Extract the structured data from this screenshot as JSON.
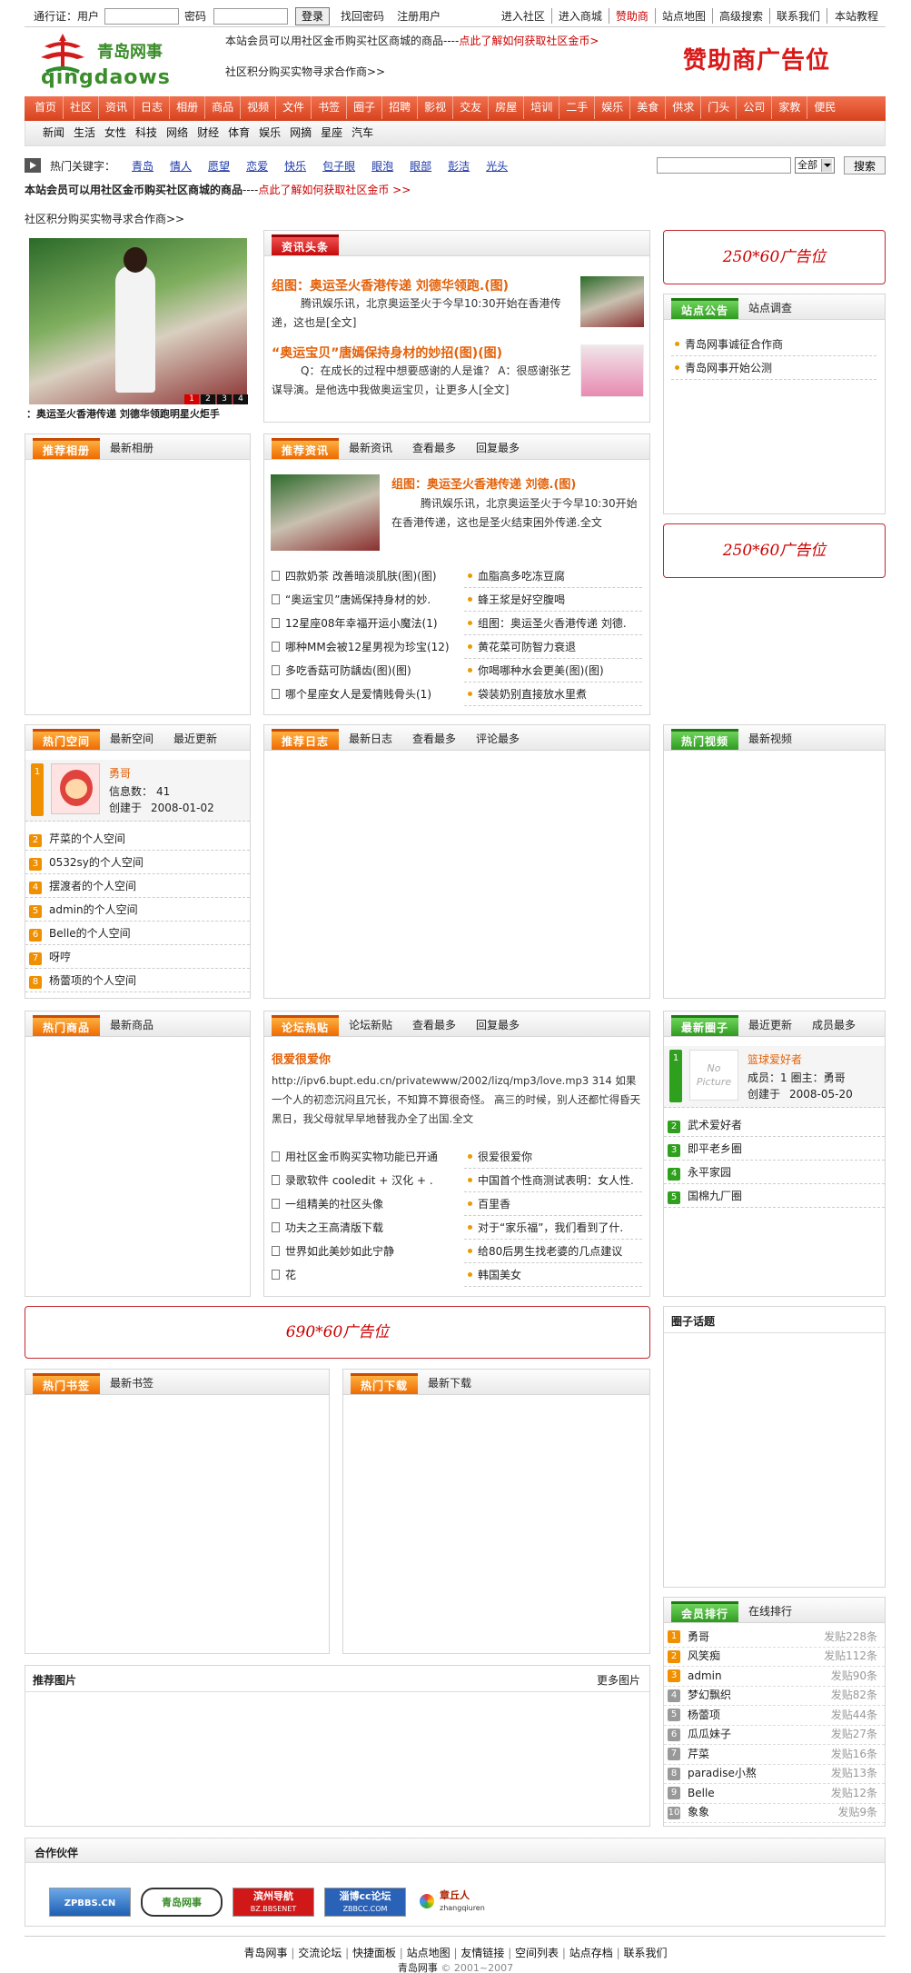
{
  "top": {
    "pass_label": "通行证：用户",
    "pwd_label": "密码",
    "login_btn": "登录",
    "retrieve": "找回密码",
    "register": "注册用户",
    "links": [
      "进入社区",
      "进入商城",
      "赞助商",
      "站点地图",
      "高级搜索",
      "联系我们",
      "本站教程"
    ]
  },
  "logo": {
    "cn": "青岛网事",
    "en": "qingdaows"
  },
  "notice": {
    "line1a": "本站会员可以用社区金币购买社区商城的商品----",
    "line1b": "点此了解如何获取社区金币>",
    "line2": "社区积分购买实物寻求合作商>>"
  },
  "sponsor": "赞助商广告位",
  "nav": [
    "首页",
    "社区",
    "资讯",
    "日志",
    "相册",
    "商品",
    "视频",
    "文件",
    "书签",
    "圈子",
    "招聘",
    "影视",
    "交友",
    "房屋",
    "培训",
    "二手",
    "娱乐",
    "美食",
    "供求",
    "门头",
    "公司",
    "家教",
    "便民"
  ],
  "subnav": [
    "新闻",
    "生活",
    "女性",
    "科技",
    "网络",
    "财经",
    "体育",
    "娱乐",
    "网摘",
    "星座",
    "汽车"
  ],
  "hot": {
    "label": "热门关键字：",
    "words": [
      "青岛",
      "情人",
      "愿望",
      "恋爱",
      "快乐",
      "包子眼",
      "眼泡",
      "眼部",
      "彭洁",
      "光头"
    ],
    "select": "全部",
    "search_btn": "搜索"
  },
  "notice2": {
    "a": "本站会员可以用社区金币购买社区商城的商品",
    "b": "----",
    "c": "点此了解如何获取社区金币 >>",
    "d": "社区积分购买实物寻求合作商>>"
  },
  "slide": {
    "caption": "：奥运圣火香港传递 刘德华领跑明星火炬手",
    "pages": [
      "1",
      "2",
      "3",
      "4"
    ]
  },
  "news_head": {
    "tab": "资讯头条",
    "item1": {
      "title": "组图：奥运圣火香港传递 刘德华领跑.(图)",
      "text": "腾讯娱乐讯，北京奥运圣火于今早10:30开始在香港传递，这也是",
      "more": "[全文]"
    },
    "item2": {
      "title": "“奥运宝贝”唐嫣保持身材的妙招(图)(图)",
      "text": "Q：在成长的过程中想要感谢的人是谁？ A：很感谢张艺谋导演。是他选中我做奥运宝贝，让更多人",
      "more": "[全文]"
    }
  },
  "ad1": "250*60广告位",
  "ad2": "250*60广告位",
  "ad_mid": "690*60广告位",
  "site": {
    "tabs": [
      "站点公告",
      "站点调查"
    ],
    "items": [
      "青岛网事诚征合作商",
      "青岛网事开始公测"
    ]
  },
  "album": {
    "tabs": [
      "推荐相册",
      "最新相册"
    ]
  },
  "rec": {
    "tabs": [
      "推荐资讯",
      "最新资讯",
      "查看最多",
      "回复最多"
    ],
    "title": "组图：奥运圣火香港传递 刘德.(图)",
    "text": "腾讯娱乐讯，北京奥运圣火于今早10:30开始在香港传递，这也是圣火结束困外传递.",
    "more": "全文",
    "left": [
      "四款奶茶 改善暗淡肌肤(图)(图)",
      "“奥运宝贝”唐嫣保持身材的妙.",
      "12星座08年幸福开运小魔法(1)",
      "哪种MM会被12星男视为珍宝(12)",
      "多吃香菇可防龋齿(图)(图)",
      "哪个星座女人是爱情贱骨头(1)"
    ],
    "right": [
      "血脂高多吃冻豆腐",
      "蜂王浆是好空腹喝",
      "组图：奥运圣火香港传递 刘德.",
      "黄花菜可防智力衰退",
      "你喝哪种水会更美(图)(图)",
      "袋装奶别直接放水里煮"
    ]
  },
  "space": {
    "tabs": [
      "热门空间",
      "最新空间",
      "最近更新"
    ],
    "user": "勇哥",
    "info_label": "信息数：",
    "info": "41",
    "created_label": "创建于",
    "created": "2008-01-02",
    "items": [
      "芹菜的个人空间",
      "0532sy的个人空间",
      "摆渡者的个人空间",
      "admin的个人空间",
      "Belle的个人空间",
      "呀哼",
      "杨蕾项的个人空间"
    ],
    "nums": [
      "2",
      "3",
      "4",
      "5",
      "6",
      "7",
      "8"
    ]
  },
  "diary": {
    "tabs": [
      "推荐日志",
      "最新日志",
      "查看最多",
      "评论最多"
    ]
  },
  "video": {
    "tabs": [
      "热门视频",
      "最新视频"
    ]
  },
  "goods": {
    "tabs": [
      "热门商品",
      "最新商品"
    ]
  },
  "forum": {
    "tabs": [
      "论坛热贴",
      "论坛新贴",
      "查看最多",
      "回复最多"
    ],
    "title": "很爱很爱你",
    "text": "http://ipv6.bupt.edu.cn/privatewww/2002/lizq/mp3/love.mp3 314 如果一个人的初恋沉闷且冗长，不知算不算很奇怪。 高三的时候，别人还都忙得昏天黑日，我父母就早早地替我办全了出国.",
    "more": "全文",
    "left": [
      "用社区金币购买实物功能已开通",
      "录歌软件 cooledit + 汉化 + .",
      "一组精美的社区头像",
      "功夫之王高清版下载",
      "世界如此美妙如此宁静",
      "花"
    ],
    "right": [
      "很爱很爱你",
      "中国首个性商测试表明：女人性.",
      "百里香",
      "对于“家乐福”，我们看到了什.",
      "给80后男生找老婆的几点建议",
      "韩国美女"
    ]
  },
  "circle": {
    "tabs": [
      "最新圈子",
      "最近更新",
      "成员最多"
    ],
    "name": "篮球爱好者",
    "no_pic": "No Picture",
    "members_label": "成员：",
    "members": "1",
    "owner_label": "圈主：",
    "owner": "勇哥",
    "created_label": "创建于",
    "created": "2008-05-20",
    "items": [
      "武术爱好者",
      "即平老乡圈",
      "永平家园",
      "国棉九厂圈"
    ],
    "nums": [
      "2",
      "3",
      "4",
      "5"
    ]
  },
  "topic": {
    "title": "圈子话题"
  },
  "bookmark": {
    "tabs": [
      "热门书签",
      "最新书签"
    ]
  },
  "download": {
    "tabs": [
      "热门下载",
      "最新下载"
    ]
  },
  "member": {
    "tabs": [
      "会员排行",
      "在线排行"
    ],
    "rows": [
      {
        "name": "勇哥",
        "posts": "发贴228条"
      },
      {
        "name": "风笑痴",
        "posts": "发贴112条"
      },
      {
        "name": "admin",
        "posts": "发贴90条"
      },
      {
        "name": "梦幻飘织",
        "posts": "发贴82条"
      },
      {
        "name": "杨蕾项",
        "posts": "发贴44条"
      },
      {
        "name": "瓜瓜妹子",
        "posts": "发贴27条"
      },
      {
        "name": "芹菜",
        "posts": "发贴16条"
      },
      {
        "name": "paradise小熬",
        "posts": "发贴13条"
      },
      {
        "name": "Belle",
        "posts": "发贴12条"
      },
      {
        "name": "象象",
        "posts": "发贴9条"
      }
    ],
    "nums": [
      "1",
      "2",
      "3",
      "4",
      "5",
      "6",
      "7",
      "8",
      "9",
      "10"
    ]
  },
  "pics": {
    "title": "推荐图片",
    "more": "更多图片"
  },
  "partners": {
    "title": "合作伙伴",
    "items": [
      "ZPBBS.CN",
      "青岛网事",
      "滨州导航",
      "淄博cc论坛",
      "章丘人"
    ],
    "subs": [
      "",
      "",
      "BZ.BBSENET",
      "ZBBCC.COM",
      "zhangqiuren"
    ]
  },
  "footer": {
    "links": [
      "青岛网事",
      "交流论坛",
      "快捷面板",
      "站点地图",
      "友情链接",
      "空间列表",
      "站点存档",
      "联系我们"
    ],
    "site": "青岛网事",
    "copy": "© 2001~2007"
  },
  "colors": {
    "accent": "#e8542f",
    "orange": "#f07000",
    "green": "#2fa01d",
    "red": "#c0282d"
  }
}
